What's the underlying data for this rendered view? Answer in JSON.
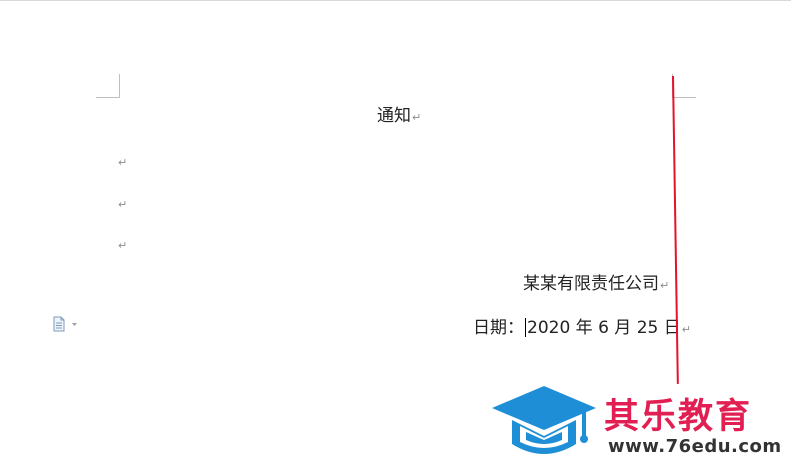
{
  "document": {
    "title": "通知",
    "paragraph_mark": "↵",
    "company": "某某有限责任公司",
    "date_label": "日期：",
    "date_value": "2020 年 6 月 25 日"
  },
  "icons": {
    "paste_options": "paste-options-icon",
    "mortarboard": "mortarboard-icon"
  },
  "watermark": {
    "brand": "其乐教育",
    "url": "www.76edu.com",
    "colors": {
      "brand": "#e21f52",
      "logo": "#1e8fd6",
      "url": "#333333"
    }
  },
  "annotation": {
    "color": "#e8102a"
  }
}
